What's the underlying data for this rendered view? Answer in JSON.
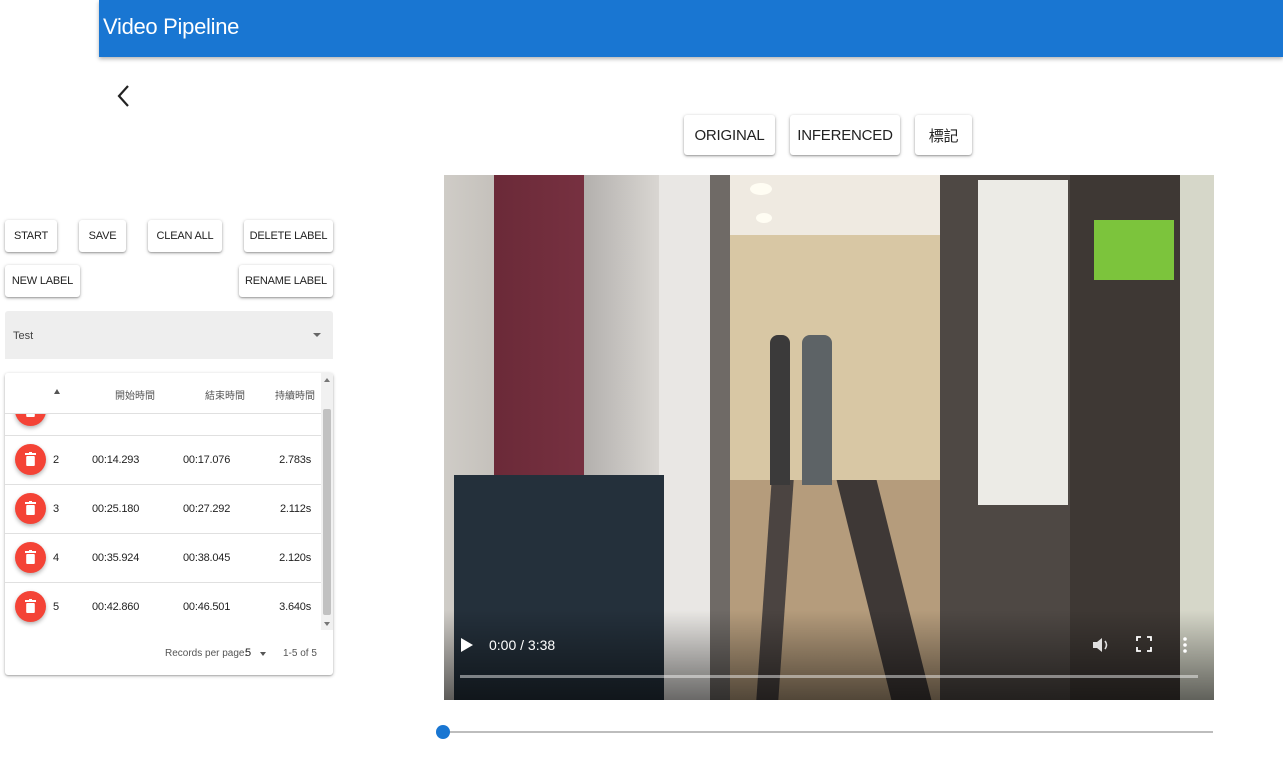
{
  "app": {
    "title": "Video Pipeline"
  },
  "view_buttons": {
    "original": "ORIGINAL",
    "inferenced": "INFERENCED",
    "label": "標記"
  },
  "actions": {
    "start": "START",
    "save": "SAVE",
    "clean_all": "CLEAN ALL",
    "delete_label": "DELETE LABEL",
    "new_label": "NEW LABEL",
    "rename_label": "RENAME LABEL"
  },
  "label_select": {
    "value": "Test"
  },
  "table": {
    "headers": {
      "index": "#",
      "start": "開始時間",
      "end": "結束時間",
      "duration": "持續時間"
    },
    "rows": [
      {
        "index": "2",
        "start": "00:14.293",
        "end": "00:17.076",
        "duration": "2.783s"
      },
      {
        "index": "3",
        "start": "00:25.180",
        "end": "00:27.292",
        "duration": "2.112s"
      },
      {
        "index": "4",
        "start": "00:35.924",
        "end": "00:38.045",
        "duration": "2.120s"
      },
      {
        "index": "5",
        "start": "00:42.860",
        "end": "00:46.501",
        "duration": "3.640s"
      }
    ],
    "footer": {
      "rows_per_page_label": "Records per page:",
      "rows_per_page": "5",
      "range": "1-5 of 5"
    }
  },
  "video": {
    "time_display": "0:00 / 3:38",
    "progress": 0.0
  },
  "timeline_slider": {
    "value": 0
  },
  "colors": {
    "primary": "#1976d2",
    "danger": "#f44336"
  },
  "icons": [
    "chevron-left-icon",
    "trash-icon",
    "play-icon",
    "volume-icon",
    "fullscreen-icon",
    "more-vert-icon",
    "sort-arrow-icon"
  ]
}
